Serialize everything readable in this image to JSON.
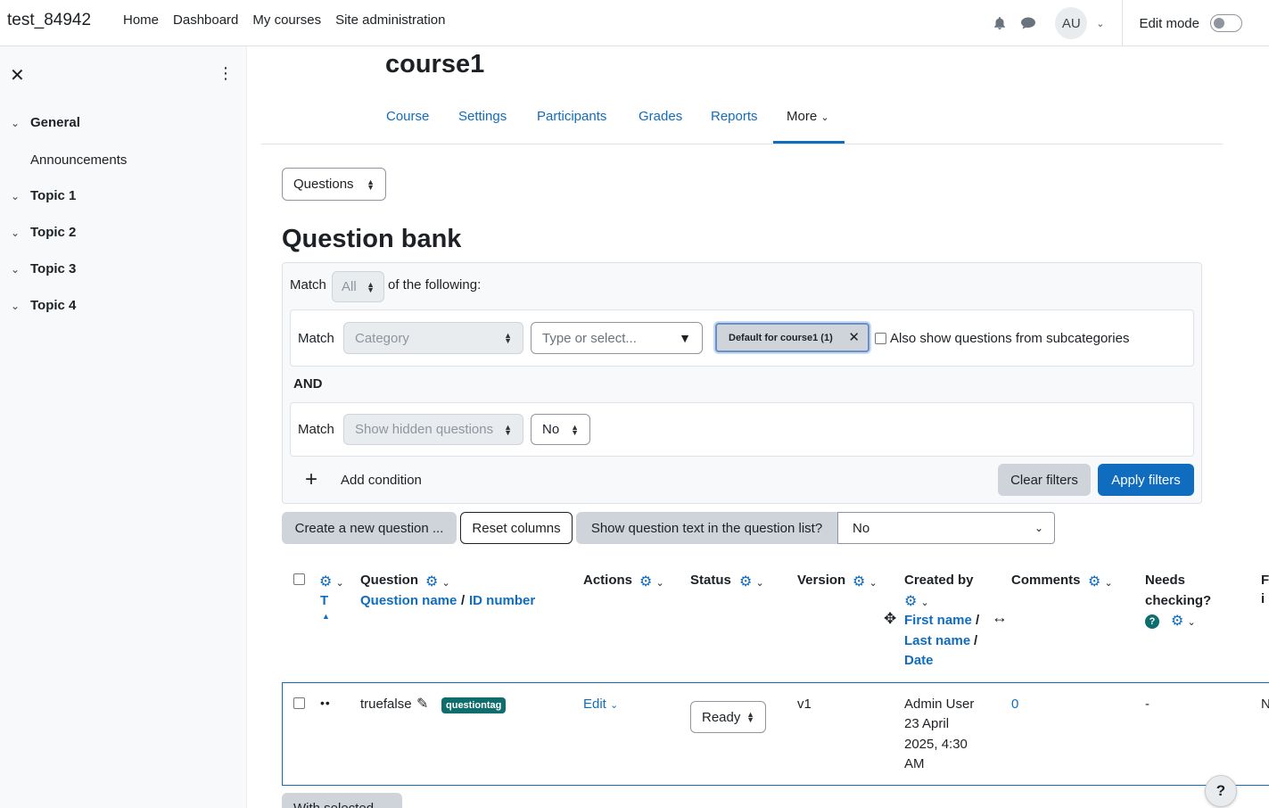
{
  "navbar": {
    "brand": "test_84942",
    "items": [
      "Home",
      "Dashboard",
      "My courses",
      "Site administration"
    ],
    "avatar_initials": "AU",
    "edit_mode_label": "Edit mode"
  },
  "drawer": {
    "sections": [
      {
        "label": "General",
        "children": [
          "Announcements"
        ]
      },
      {
        "label": "Topic 1"
      },
      {
        "label": "Topic 2"
      },
      {
        "label": "Topic 3"
      },
      {
        "label": "Topic 4"
      }
    ]
  },
  "course": {
    "title": "course1",
    "tabs": [
      "Course",
      "Settings",
      "Participants",
      "Grades",
      "Reports"
    ],
    "more_label": "More"
  },
  "bank_select": "Questions",
  "page_heading": "Question bank",
  "filters": {
    "match_label": "Match",
    "match_value": "All",
    "of_following": "of the following:",
    "row1": {
      "match": "Match",
      "type": "Category",
      "placeholder": "Type or select...",
      "chip": "Default for course1 (1)",
      "subcat_label": "Also show questions from subcategories"
    },
    "and_label": "AND",
    "row2": {
      "match": "Match",
      "type": "Show hidden questions",
      "value": "No"
    },
    "add_condition": "Add condition",
    "clear": "Clear filters",
    "apply": "Apply filters"
  },
  "toolbar": {
    "create": "Create a new question ...",
    "reset": "Reset columns",
    "show_text_label": "Show question text in the question list?",
    "show_text_value": "No"
  },
  "table": {
    "col_t": "T",
    "col_question": "Question",
    "col_question_name": "Question name",
    "col_id_number": "ID number",
    "col_actions": "Actions",
    "col_status": "Status",
    "col_version": "Version",
    "col_created_by": "Created by",
    "col_first_name": "First name",
    "col_last_name": "Last name",
    "col_date": "Date",
    "col_comments": "Comments",
    "col_needs_1": "Needs",
    "col_needs_2": "checking?",
    "rows": [
      {
        "name": "truefalse",
        "tag": "questiontag",
        "action": "Edit",
        "status": "Ready",
        "version": "v1",
        "created_by": "Admin User",
        "date_1": "23 April",
        "date_2": "2025, 4:30",
        "date_3": "AM",
        "comments": "0",
        "needs_checking": "-"
      }
    ]
  },
  "with_selected": "With selected"
}
